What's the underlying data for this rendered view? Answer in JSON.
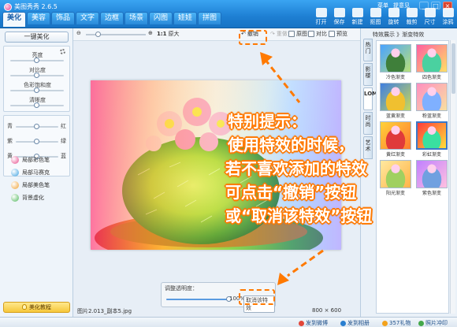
{
  "app": {
    "title": "美图秀秀 2.6.5"
  },
  "tabs": [
    "美化",
    "美容",
    "饰品",
    "文字",
    "边框",
    "场景",
    "闪图",
    "娃娃",
    "拼图"
  ],
  "top_links": [
    "菜单",
    "提意见"
  ],
  "window_buttons": [
    "_",
    "□",
    "×"
  ],
  "toolbar": [
    {
      "label": "打开",
      "icon": "folder-open-icon"
    },
    {
      "label": "保存",
      "icon": "save-icon"
    },
    {
      "label": "新建",
      "icon": "new-file-icon"
    },
    {
      "label": "抠图",
      "icon": "cutout-icon"
    },
    {
      "label": "旋转",
      "icon": "rotate-icon"
    },
    {
      "label": "裁剪",
      "icon": "crop-icon"
    },
    {
      "label": "尺寸",
      "icon": "resize-icon"
    },
    {
      "label": "涂鸦",
      "icon": "brush-icon"
    },
    {
      "label": "消除",
      "icon": "eraser-icon"
    }
  ],
  "left": {
    "beautify_button": "一键美化",
    "sliders_basic": [
      {
        "label": "亮度",
        "value": 0.5
      },
      {
        "label": "对比度",
        "value": 0.5
      },
      {
        "label": "色彩饱和度",
        "value": 0.5
      },
      {
        "label": "清晰度",
        "value": 0.5
      }
    ],
    "sliders_color": [
      {
        "left": "青",
        "right": "红",
        "value": 0.5
      },
      {
        "left": "紫",
        "right": "绿",
        "value": 0.5
      },
      {
        "left": "黄",
        "right": "蓝",
        "value": 0.5
      }
    ],
    "brushes": [
      {
        "label": "局部彩色笔",
        "color": "#e74c8c"
      },
      {
        "label": "局部马赛克",
        "color": "#3aa0e0"
      },
      {
        "label": "局部美色笔",
        "color": "#f0a030"
      },
      {
        "label": "背景虚化",
        "color": "#4fb85a"
      }
    ],
    "tutorial_button": "美化教程"
  },
  "center": {
    "zoom_label": "1:1",
    "zoom_value": "原大",
    "undo": "撤销",
    "redo": "重做",
    "original": "原图",
    "compare": "对比",
    "preview": "预览",
    "opacity_label": "调整透明度：",
    "opacity_value": "100%",
    "opacity_level": 1.0,
    "cancel_effect": "取消该特效",
    "file_name": "图片2.013_副本5.jpg",
    "dimensions": "800 × 600"
  },
  "right": {
    "title": "特效展示 》渐变特效",
    "vertical_tabs": [
      "热门",
      "影楼",
      "LOMO",
      "时尚",
      "艺术"
    ],
    "active_vtab": 2,
    "thumbs": [
      {
        "label": "冷色渐变",
        "colors": [
          "#4aa3ff",
          "#b8e07a",
          "#3f7f3a"
        ]
      },
      {
        "label": "四色渐变",
        "colors": [
          "#ff5fa0",
          "#ffe066",
          "#4ad1a0"
        ]
      },
      {
        "label": "蓝黄渐变",
        "colors": [
          "#3f7fe0",
          "#c8d85a",
          "#f0c030"
        ]
      },
      {
        "label": "粉蓝渐变",
        "colors": [
          "#ff8fc0",
          "#f8e0a0",
          "#7fb0ff"
        ]
      },
      {
        "label": "黄红渐变",
        "colors": [
          "#ffd23a",
          "#ff7a30",
          "#e03a3a"
        ]
      },
      {
        "label": "彩虹渐变",
        "colors": [
          "#ff3a3a",
          "#ffe03a",
          "#3ae0a0"
        ]
      },
      {
        "label": "阳光渐变",
        "colors": [
          "#ffe9a0",
          "#ffb347",
          "#a0d060"
        ]
      },
      {
        "label": "紫色渐变",
        "colors": [
          "#c080ff",
          "#ffc0e0",
          "#70a0e0"
        ]
      }
    ],
    "selected_thumb": 5
  },
  "bottom_links": [
    "发到微博",
    "发到相册",
    "357礼物",
    "照片冲印"
  ],
  "tip": {
    "lines": [
      "特别提示：",
      "使用特效的时候，",
      "若不喜欢添加的特效",
      "可点击“撤销”按钮",
      "或“取消该特效”按钮"
    ]
  },
  "colors": {
    "accent": "#ff7900",
    "header": "#1e7fd3"
  }
}
